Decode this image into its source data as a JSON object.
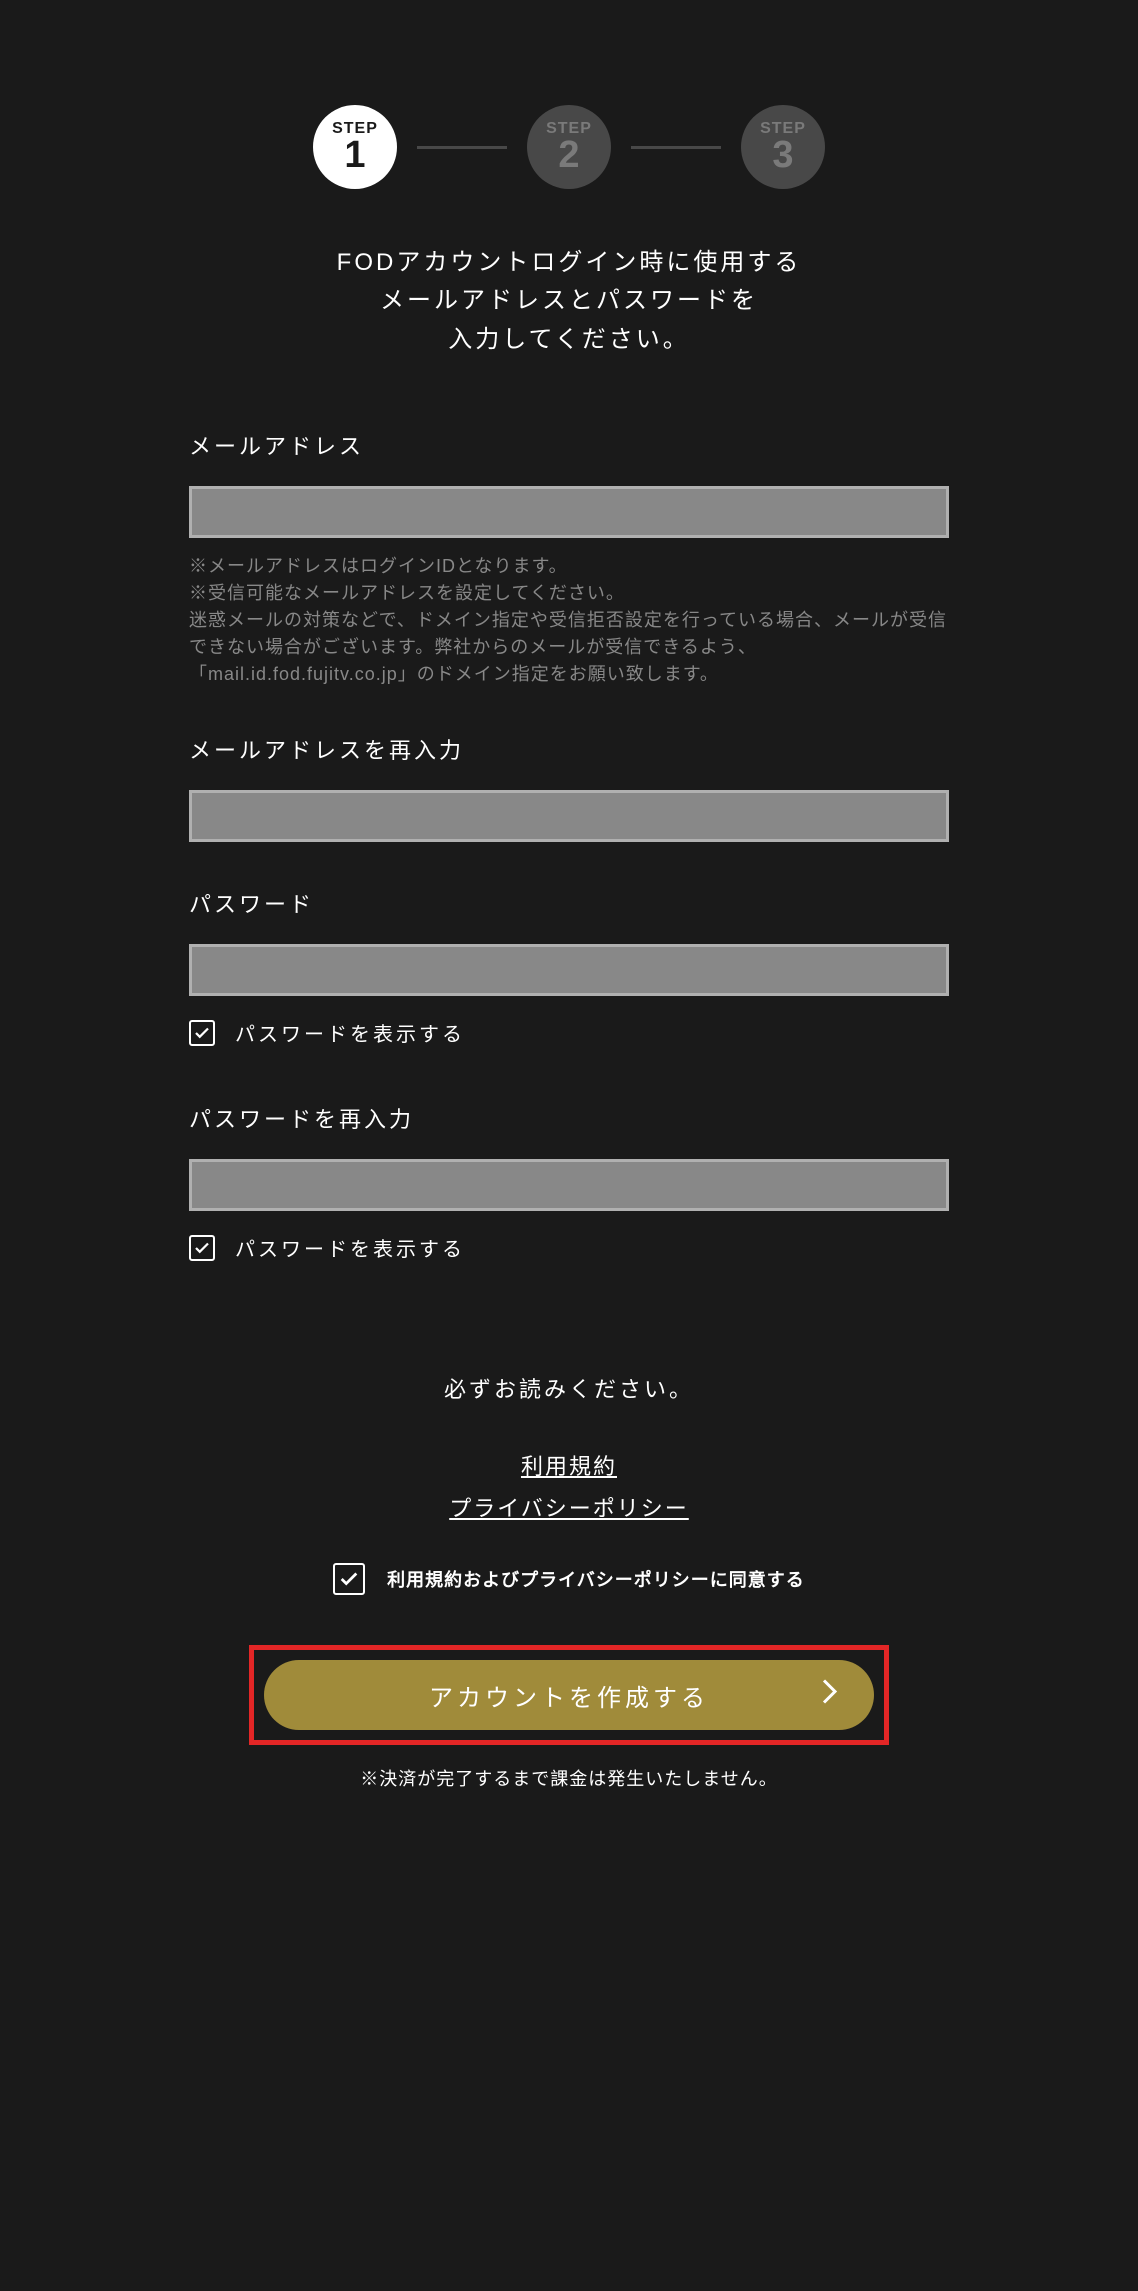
{
  "steps": {
    "step1": {
      "label": "STEP",
      "number": "1"
    },
    "step2": {
      "label": "STEP",
      "number": "2"
    },
    "step3": {
      "label": "STEP",
      "number": "3"
    }
  },
  "instructions": {
    "line1": "FODアカウントログイン時に使用する",
    "line2": "メールアドレスとパスワードを",
    "line3": "入力してください。"
  },
  "form": {
    "email": {
      "label": "メールアドレス",
      "help1": "※メールアドレスはログインIDとなります。",
      "help2": "※受信可能なメールアドレスを設定してください。",
      "help3": "迷惑メールの対策などで、ドメイン指定や受信拒否設定を行っている場合、メールが受信できない場合がございます。弊社からのメールが受信できるよう、「mail.id.fod.fujitv.co.jp」のドメイン指定をお願い致します。"
    },
    "emailConfirm": {
      "label": "メールアドレスを再入力"
    },
    "password": {
      "label": "パスワード",
      "showLabel": "パスワードを表示する"
    },
    "passwordConfirm": {
      "label": "パスワードを再入力",
      "showLabel": "パスワードを表示する"
    }
  },
  "agreement": {
    "title": "必ずお読みください。",
    "termsLink": "利用規約",
    "privacyLink": "プライバシーポリシー",
    "checkboxLabel": "利用規約およびプライバシーポリシーに同意する"
  },
  "submit": {
    "buttonLabel": "アカウントを作成する",
    "footerNote": "※決済が完了するまで課金は発生いたしません。"
  }
}
